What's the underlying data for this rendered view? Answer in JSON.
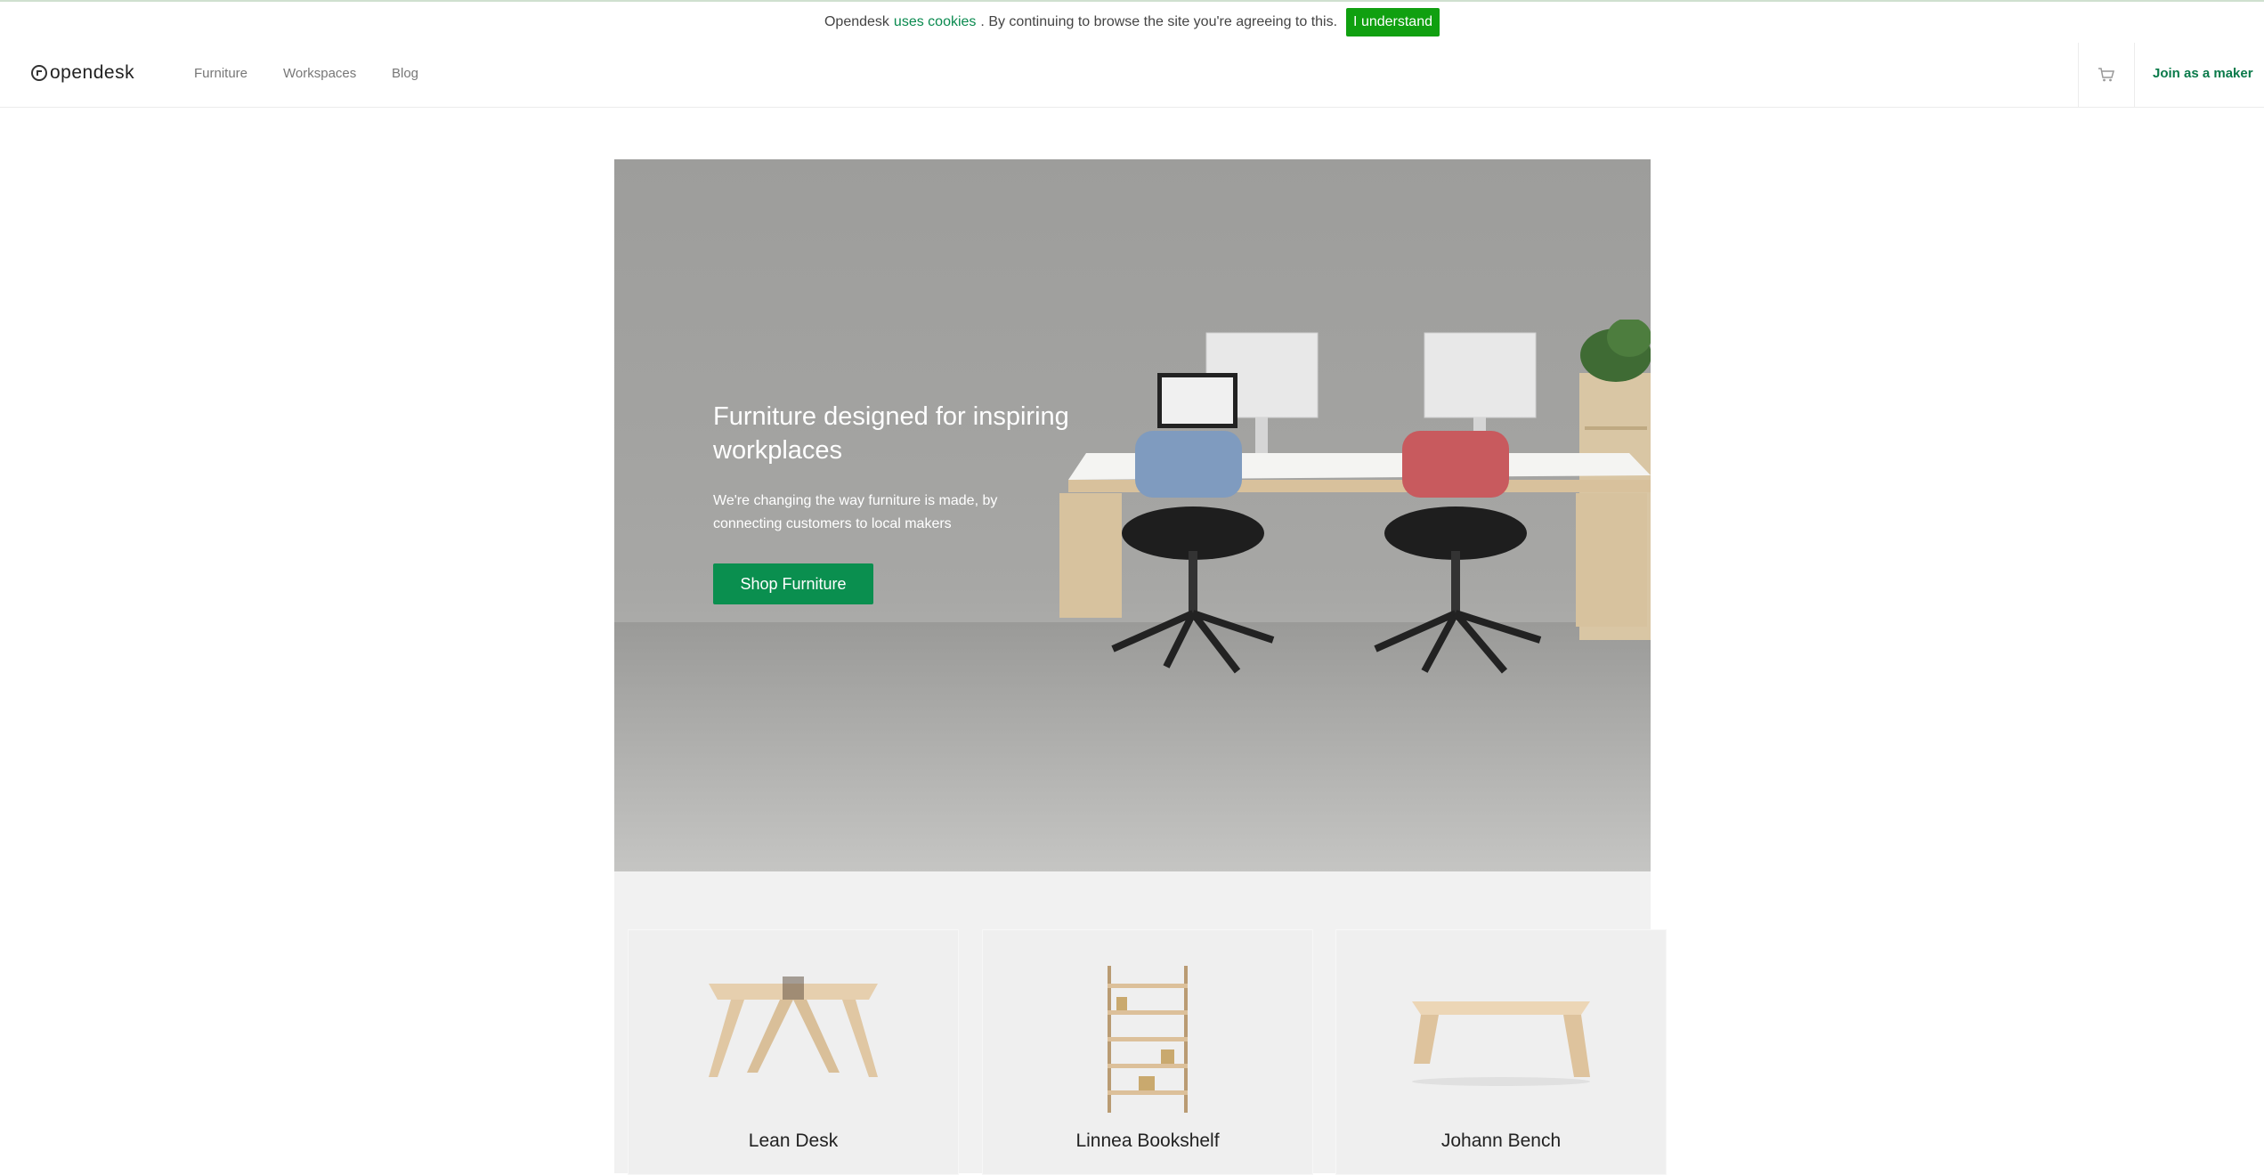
{
  "cookie_bar": {
    "text_before": "Opendesk",
    "link": "uses cookies",
    "text_after": ". By continuing to browse the site you're agreeing to this.",
    "button": "I understand"
  },
  "nav": {
    "logo": "opendesk",
    "links": [
      "Furniture",
      "Workspaces",
      "Blog"
    ],
    "cart_icon": "cart-icon",
    "maker": "Join as a maker"
  },
  "hero": {
    "title": "Furniture designed for inspiring workplaces",
    "subtitle": "We're changing the way furniture is made, by connecting customers to local makers",
    "button": "Shop Furniture"
  },
  "products": [
    {
      "name": "Lean Desk"
    },
    {
      "name": "Linnea Bookshelf"
    },
    {
      "name": "Johann Bench"
    }
  ],
  "colors": {
    "brand_green": "#0a8f4f",
    "cookie_green": "#10a010"
  }
}
